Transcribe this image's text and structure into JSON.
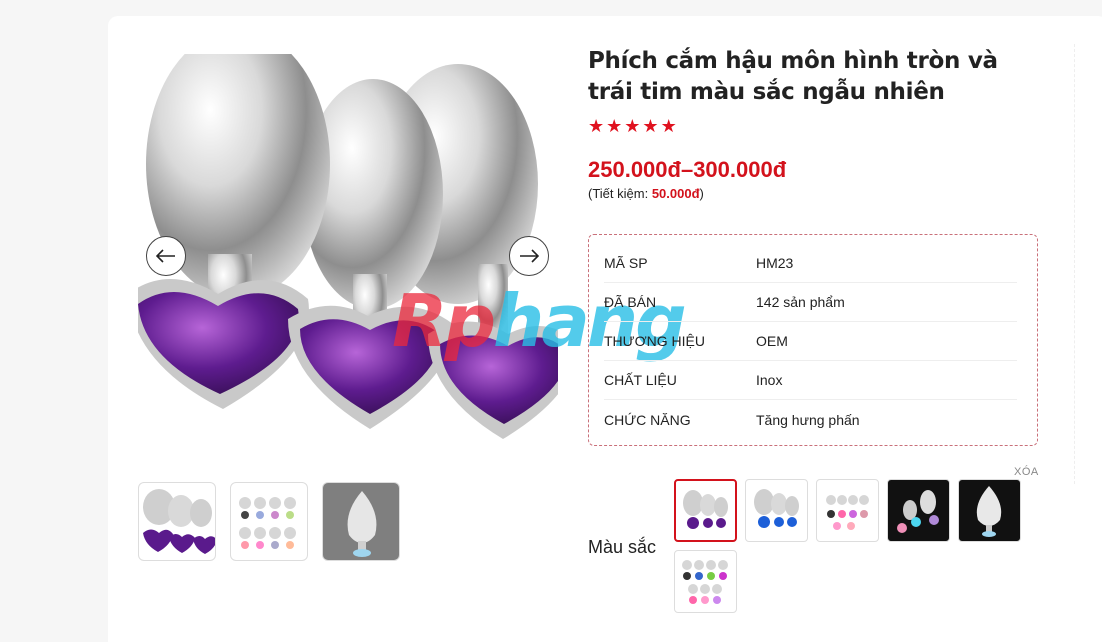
{
  "product": {
    "title": "Phích cắm hậu môn hình tròn và trái tim màu sắc ngẫu nhiên",
    "rating": 5,
    "price": "250.000đ–300.000đ",
    "saving_prefix": "(Tiết kiệm: ",
    "saving_amount": "50.000đ",
    "saving_suffix": ")"
  },
  "watermark": {
    "part1": "Rp",
    "part2": "hang"
  },
  "specs": [
    {
      "key": "Mã SP",
      "value": "HM23"
    },
    {
      "key": "Đã bán",
      "value": "142 sản phẩm"
    },
    {
      "key": "Thương hiệu",
      "value": "OEM"
    },
    {
      "key": "Chất liệu",
      "value": "Inox"
    },
    {
      "key": "Chức năng",
      "value": "Tăng hưng phấn"
    }
  ],
  "variation": {
    "label": "Màu sắc",
    "clear_label": "XÓA",
    "selected_index": 0
  },
  "colors": {
    "accent": "#d3121c",
    "purple_gem": "#5a1a8c",
    "blue_gem": "#1d5fd8"
  }
}
